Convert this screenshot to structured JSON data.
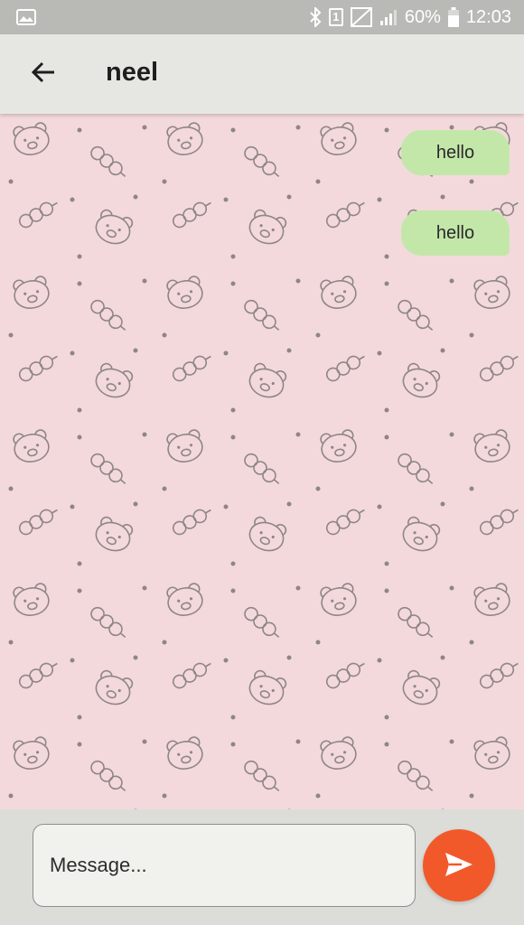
{
  "status_bar": {
    "battery": "60%",
    "time": "12:03",
    "sim_label": "1"
  },
  "header": {
    "title": "neel"
  },
  "messages": [
    {
      "text": "hello",
      "direction": "outgoing"
    },
    {
      "text": "hello",
      "direction": "outgoing"
    }
  ],
  "composer": {
    "placeholder": "Message..."
  },
  "colors": {
    "outgoing_bubble": "#c3e7a9",
    "send_button": "#f2592a",
    "wallpaper": "#f3d9dc",
    "app_bar": "#e6e7e2"
  },
  "icons": {
    "back": "arrow-left-icon",
    "send": "send-icon",
    "bluetooth": "bluetooth-icon",
    "signal": "signal-icon",
    "battery": "battery-icon",
    "notification": "gallery-notification-icon"
  }
}
